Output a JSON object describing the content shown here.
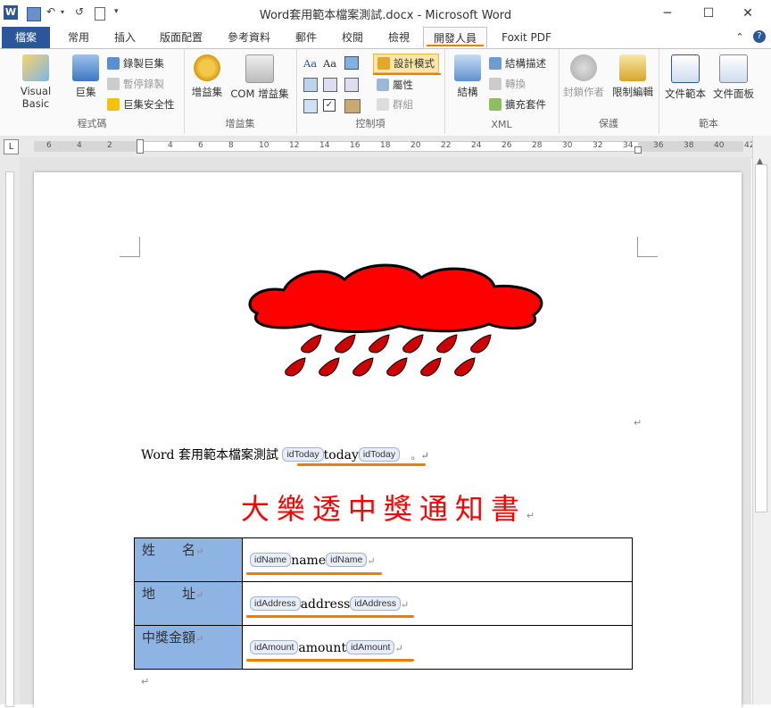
{
  "window": {
    "title": "Word套用範本檔案測試.docx - Microsoft Word",
    "app_icon": "W",
    "minimize": "─",
    "maximize": "☐",
    "close": "✕"
  },
  "tabs": [
    "檔案",
    "常用",
    "插入",
    "版面配置",
    "參考資料",
    "郵件",
    "校閱",
    "檢視",
    "開發人員",
    "Foxit PDF"
  ],
  "active_tab": "開發人員",
  "ribbon": {
    "code": {
      "label": "程式碼",
      "visual_basic": "Visual Basic",
      "macros": "巨集",
      "record_macro": "錄製巨集",
      "pause_recording": "暫停錄製",
      "macro_security": "巨集安全性"
    },
    "addins": {
      "label": "增益集",
      "addins": "增益集",
      "com_addins": "COM 增益集"
    },
    "controls": {
      "label": "控制項",
      "design_mode": "設計模式",
      "properties": "屬性",
      "group": "群組"
    },
    "xml": {
      "label": "XML",
      "structure": "結構",
      "schema": "結構描述",
      "transform": "轉換",
      "expansion_packs": "擴充套件"
    },
    "protect": {
      "label": "保護",
      "block_authors": "封鎖作者",
      "restrict_editing": "限制編輯"
    },
    "templates": {
      "label": "範本",
      "document_template": "文件範本",
      "document_panel": "文件面板"
    }
  },
  "ruler": {
    "marks": [
      "6",
      "4",
      "2",
      "2",
      "4",
      "6",
      "8",
      "10",
      "12",
      "14",
      "16",
      "18",
      "20",
      "22",
      "24",
      "26",
      "28",
      "30",
      "32",
      "34",
      "36",
      "38",
      "40",
      "42"
    ]
  },
  "document": {
    "intro_text": "Word 套用範本檔案測試",
    "today_tag": "idToday",
    "today_value": "today",
    "intro_end": "。↵",
    "heading": "大樂透中獎通知書",
    "heading_mark": "↵",
    "rows": [
      {
        "label": "姓　　名",
        "tag": "idName",
        "value": "name"
      },
      {
        "label": "地　　址",
        "tag": "idAddress",
        "value": "address"
      },
      {
        "label": "中獎金額",
        "tag": "idAmount",
        "value": "amount"
      }
    ],
    "para_mark": "↵",
    "cell_mark": "↵"
  },
  "colors": {
    "accent": "#f07d00",
    "file_tab": "#2b579a",
    "heading": "#ff0000",
    "cloud": "#ff0000",
    "label_cell": "#8eb4e3"
  }
}
